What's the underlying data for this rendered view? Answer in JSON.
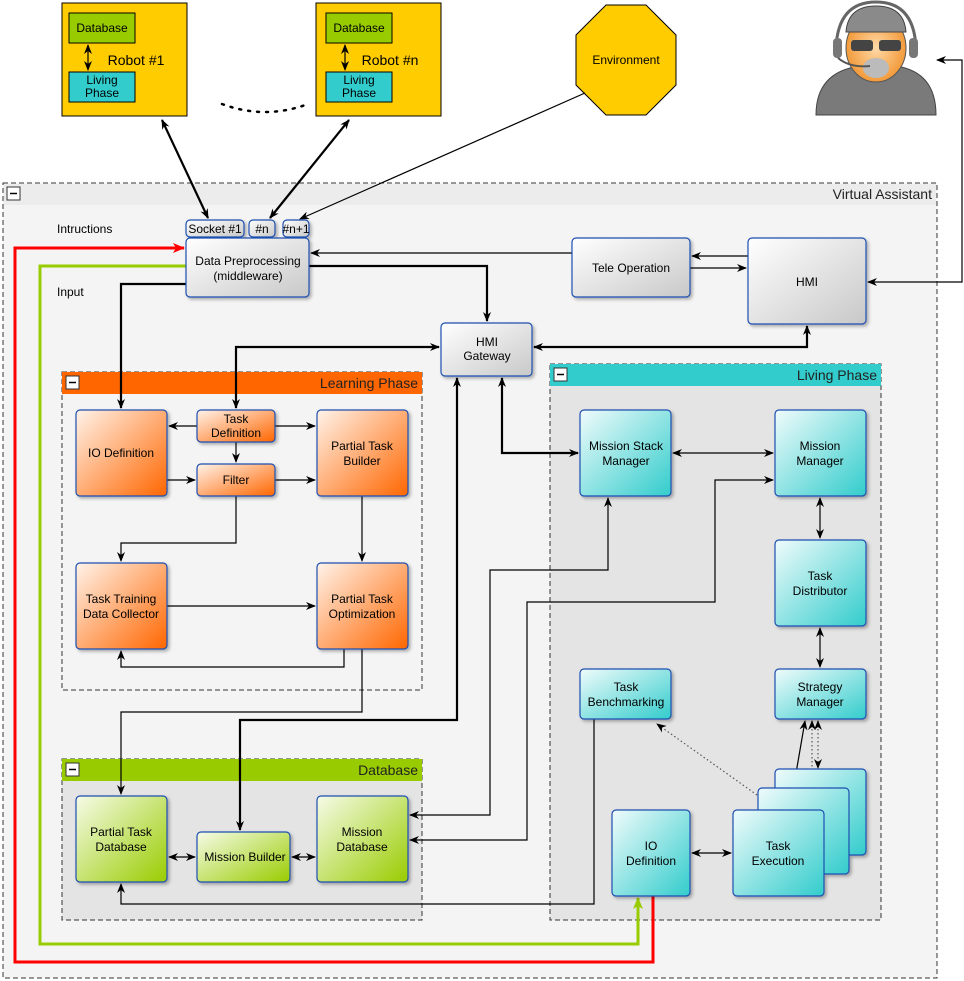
{
  "colors": {
    "robot": "#FFCC00",
    "database": "#99CC00",
    "living": "#33CCCC",
    "learning": "#FF6600",
    "red_line": "#FF0000",
    "green_line": "#99CC00"
  },
  "robots": [
    {
      "title": "Robot #1",
      "database": "Database",
      "living": [
        "Living",
        "Phase"
      ]
    },
    {
      "title": "Robot #n",
      "database": "Database",
      "living": [
        "Living",
        "Phase"
      ]
    }
  ],
  "environment": "Environment",
  "operator_icon": "operator-headset-icon",
  "virtual_assistant": {
    "title": "Virtual Assistant",
    "instructions_label": "Intructions",
    "input_label": "Input",
    "sockets": [
      "Socket #1",
      "#n",
      "#n+1"
    ],
    "data_preprocessing": [
      "Data Preprocessing",
      "(middleware)"
    ],
    "tele_operation": "Tele Operation",
    "hmi": "HMI",
    "hmi_gateway": [
      "HMI",
      "Gateway"
    ]
  },
  "learning_phase": {
    "title": "Learning Phase",
    "io_definition": "IO Definition",
    "task_definition": [
      "Task",
      "Definition"
    ],
    "filter": "Filter",
    "partial_task_builder": [
      "Partial Task",
      "Builder"
    ],
    "task_training": [
      "Task Training",
      "Data Collector"
    ],
    "partial_task_optimization": [
      "Partial Task",
      "Optimization"
    ]
  },
  "database": {
    "title": "Database",
    "partial_task_database": [
      "Partial Task",
      "Database"
    ],
    "mission_builder": "Mission Builder",
    "mission_database": [
      "Mission",
      "Database"
    ]
  },
  "living_phase": {
    "title": "Living Phase",
    "mission_stack_manager": [
      "Mission Stack",
      "Manager"
    ],
    "mission_manager": [
      "Mission",
      "Manager"
    ],
    "task_distributor": [
      "Task",
      "Distributor"
    ],
    "task_benchmarking": [
      "Task",
      "Benchmarking"
    ],
    "strategy_manager": [
      "Strategy",
      "Manager"
    ],
    "io_definition": [
      "IO",
      "Definition"
    ],
    "task_execution": [
      "Task",
      "Execution"
    ]
  }
}
